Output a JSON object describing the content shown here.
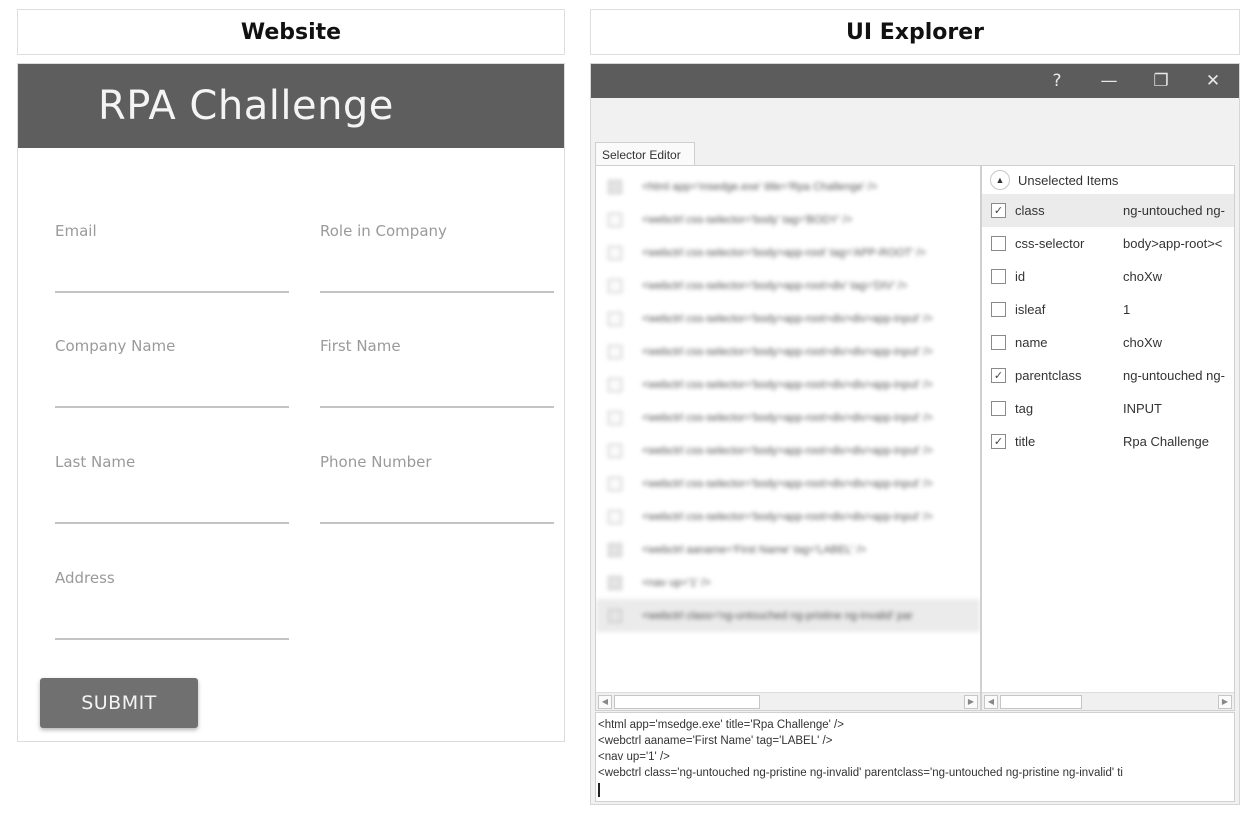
{
  "captions": {
    "left": "Website",
    "right": "UI Explorer"
  },
  "website": {
    "title": "RPA Challenge",
    "fields": [
      {
        "label": "Email",
        "value": ""
      },
      {
        "label": "Role in Company",
        "value": ""
      },
      {
        "label": "Company Name",
        "value": ""
      },
      {
        "label": "First Name",
        "value": ""
      },
      {
        "label": "Last Name",
        "value": ""
      },
      {
        "label": "Phone Number",
        "value": ""
      },
      {
        "label": "Address",
        "value": ""
      }
    ],
    "submit_label": "SUBMIT"
  },
  "explorer": {
    "titlebar": {
      "help": "?",
      "minimize": "—",
      "restore": "❐",
      "close": "✕"
    },
    "tab_label": "Selector Editor",
    "tree_rows": [
      {
        "checked": true,
        "text": "<html app='msedge.exe' title='Rpa Challenge' />"
      },
      {
        "checked": false,
        "text": "<webctrl css-selector='body' tag='BODY' />"
      },
      {
        "checked": false,
        "text": "<webctrl css-selector='body>app-root' tag='APP-ROOT' />"
      },
      {
        "checked": false,
        "text": "<webctrl css-selector='body>app-root>div' tag='DIV' />"
      },
      {
        "checked": false,
        "text": "<webctrl css-selector='body>app-root>div>div>app-input' />"
      },
      {
        "checked": false,
        "text": "<webctrl css-selector='body>app-root>div>div>app-input' />"
      },
      {
        "checked": false,
        "text": "<webctrl css-selector='body>app-root>div>div>app-input' />"
      },
      {
        "checked": false,
        "text": "<webctrl css-selector='body>app-root>div>div>app-input' />"
      },
      {
        "checked": false,
        "text": "<webctrl css-selector='body>app-root>div>div>app-input' />"
      },
      {
        "checked": false,
        "text": "<webctrl css-selector='body>app-root>div>div>app-input' />"
      },
      {
        "checked": false,
        "text": "<webctrl css-selector='body>app-root>div>div>app-input' />"
      },
      {
        "checked": true,
        "text": "<webctrl aaname='First Name' tag='LABEL' />"
      },
      {
        "checked": true,
        "text": "<nav up='1' />"
      },
      {
        "checked": true,
        "text": "<webctrl class='ng-untouched ng-pristine ng-invalid' par"
      }
    ],
    "unselected_label": "Unselected Items",
    "attributes": [
      {
        "name": "class",
        "value": "ng-untouched ng-",
        "checked": true
      },
      {
        "name": "css-selector",
        "value": "body>app-root><",
        "checked": false
      },
      {
        "name": "id",
        "value": "choXw",
        "checked": false
      },
      {
        "name": "isleaf",
        "value": "1",
        "checked": false
      },
      {
        "name": "name",
        "value": "choXw",
        "checked": false
      },
      {
        "name": "parentclass",
        "value": "ng-untouched ng-",
        "checked": true
      },
      {
        "name": "tag",
        "value": "INPUT",
        "checked": false
      },
      {
        "name": "title",
        "value": "Rpa Challenge",
        "checked": true
      }
    ],
    "selector_lines": [
      "<html app='msedge.exe' title='Rpa Challenge' />",
      "<webctrl aaname='First Name' tag='LABEL' />",
      "<nav up='1' />",
      "<webctrl class='ng-untouched ng-pristine ng-invalid' parentclass='ng-untouched ng-pristine ng-invalid' ti"
    ],
    "scroll_arrows": {
      "left": "◀",
      "right": "▶"
    },
    "collapse_icon": "▲",
    "check_glyph": "✓"
  }
}
